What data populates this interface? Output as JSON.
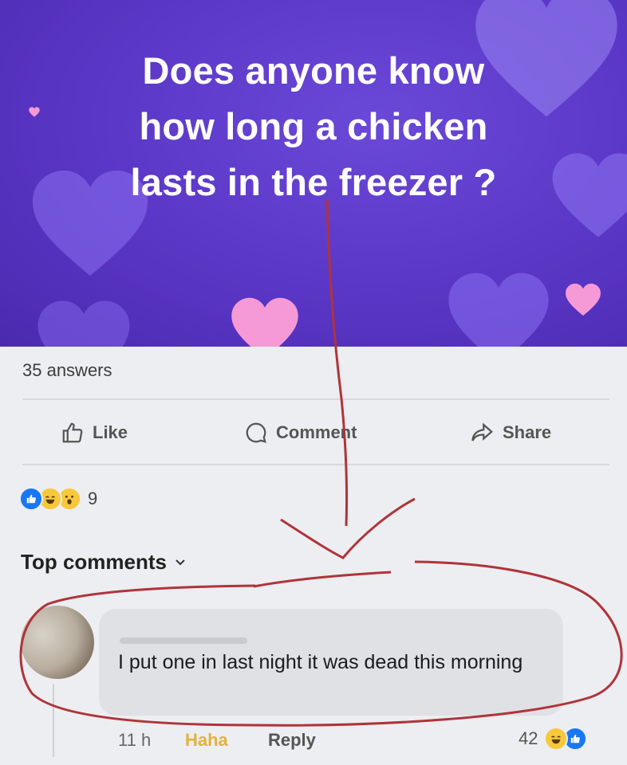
{
  "post": {
    "question": "Does anyone know\nhow long a chicken\nlasts in the freezer ?",
    "answers": "35 answers"
  },
  "actions": {
    "like": "Like",
    "comment": "Comment",
    "share": "Share"
  },
  "reactions": {
    "count": "9",
    "types": [
      "like",
      "haha",
      "wow"
    ]
  },
  "comments_header": "Top comments",
  "comment": {
    "text": "I put one in last night it was dead this morning",
    "time": "11 h",
    "haha": "Haha",
    "reply": "Reply",
    "reaction_count": "42"
  },
  "colors": {
    "background_purple": "#5a36c6",
    "heart_lilac": "#8a6ff0",
    "heart_pink": "#f59ad6",
    "annotation_red": "#b0333a",
    "like_blue": "#1877f2",
    "haha_yellow": "#f7c83a"
  }
}
